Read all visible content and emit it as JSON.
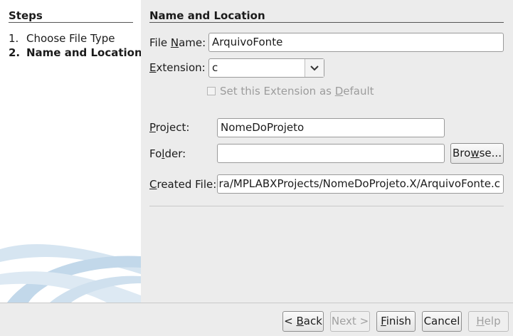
{
  "steps": {
    "title": "Steps",
    "items": [
      {
        "num": "1.",
        "label": "Choose File Type"
      },
      {
        "num": "2.",
        "label": "Name and Location"
      }
    ]
  },
  "section": {
    "title": "Name and Location"
  },
  "form": {
    "file_name": {
      "pre": "File ",
      "mn": "N",
      "post": "ame:",
      "value": "ArquivoFonte"
    },
    "extension": {
      "pre": "",
      "mn": "E",
      "post": "xtension:",
      "value": "c"
    },
    "set_default": {
      "pre": "Set this Extension as ",
      "mn": "D",
      "post": "efault",
      "checked": false
    },
    "project": {
      "pre": "",
      "mn": "P",
      "post": "roject:",
      "value": "NomeDoProjeto"
    },
    "folder": {
      "pre": "Fo",
      "mn": "l",
      "post": "der:",
      "value": ""
    },
    "browse": {
      "pre": "Bro",
      "mn": "w",
      "post": "se..."
    },
    "created_file": {
      "pre": "",
      "mn": "C",
      "post": "reated File:",
      "value": "ira/MPLABXProjects/NomeDoProjeto.X/ArquivoFonte.c"
    }
  },
  "buttons": {
    "back": {
      "pre": "< ",
      "mn": "B",
      "post": "ack"
    },
    "next": {
      "pre": "Next >",
      "mn": "",
      "post": ""
    },
    "finish": {
      "pre": "",
      "mn": "F",
      "post": "inish"
    },
    "cancel": {
      "pre": "Cancel",
      "mn": "",
      "post": ""
    },
    "help": {
      "pre": "",
      "mn": "H",
      "post": "elp"
    }
  },
  "colors": {
    "accent_swoosh": "#b9d3e6",
    "panel": "#ececec",
    "sidebar": "#ffffff"
  }
}
